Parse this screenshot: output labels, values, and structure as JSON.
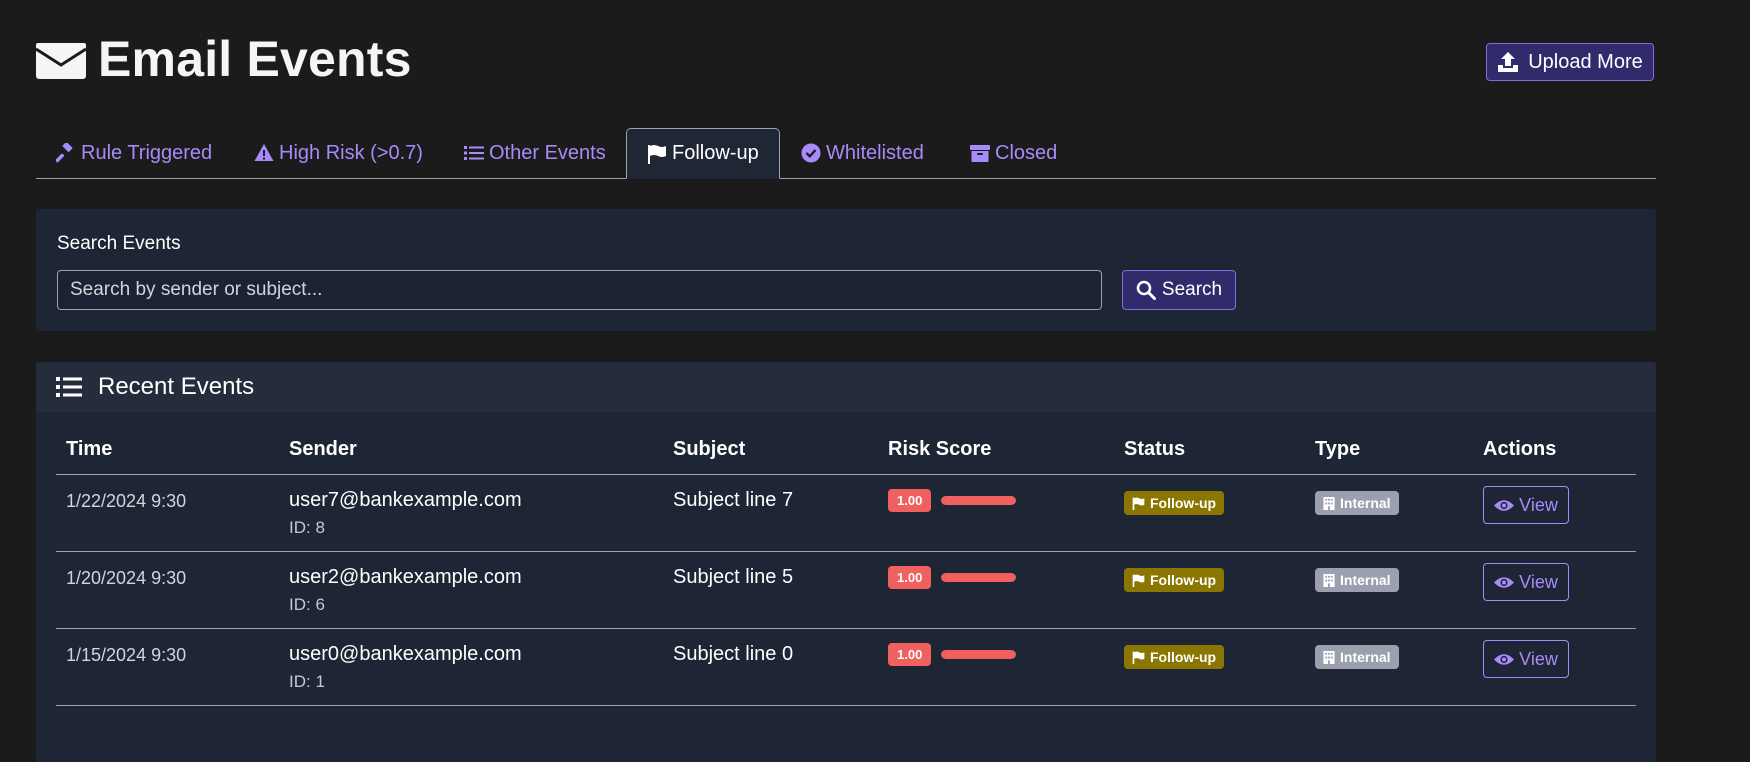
{
  "header": {
    "title": "Email Events",
    "upload_label": "Upload More"
  },
  "tabs": [
    {
      "label": "Rule Triggered",
      "icon": "gavel-icon"
    },
    {
      "label": "High Risk (>0.7)",
      "icon": "warning-icon"
    },
    {
      "label": "Other Events",
      "icon": "list-icon"
    },
    {
      "label": "Follow-up",
      "icon": "flag-icon",
      "active": true
    },
    {
      "label": "Whitelisted",
      "icon": "check-circle-icon"
    },
    {
      "label": "Closed",
      "icon": "archive-icon"
    }
  ],
  "search": {
    "label": "Search Events",
    "placeholder": "Search by sender or subject...",
    "value": "",
    "button_label": "Search"
  },
  "events": {
    "title": "Recent Events",
    "columns": [
      "Time",
      "Sender",
      "Subject",
      "Risk Score",
      "Status",
      "Type",
      "Actions"
    ],
    "rows": [
      {
        "time": "1/22/2024 9:30",
        "sender": "user7@bankexample.com",
        "id": "ID: 8",
        "subject": "Subject line 7",
        "risk": "1.00",
        "risk_fraction": 1.0,
        "status": "Follow-up",
        "type": "Internal",
        "action": "View"
      },
      {
        "time": "1/20/2024 9:30",
        "sender": "user2@bankexample.com",
        "id": "ID: 6",
        "subject": "Subject line 5",
        "risk": "1.00",
        "risk_fraction": 1.0,
        "status": "Follow-up",
        "type": "Internal",
        "action": "View"
      },
      {
        "time": "1/15/2024 9:30",
        "sender": "user0@bankexample.com",
        "id": "ID: 1",
        "subject": "Subject line 0",
        "risk": "1.00",
        "risk_fraction": 1.0,
        "status": "Follow-up",
        "type": "Internal",
        "action": "View"
      }
    ]
  },
  "colors": {
    "accent": "#a78bfa",
    "button_bg": "#312b6b",
    "risk_high": "#f0605e",
    "followup": "#8a7600",
    "internal": "#9aa0ad",
    "panel": "#1e2535",
    "background": "#1b1b1b"
  }
}
